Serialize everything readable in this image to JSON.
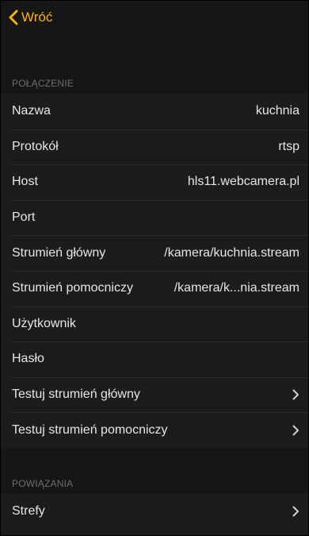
{
  "navbar": {
    "back_label": "Wróć",
    "accent_color": "#f6b400"
  },
  "sections": {
    "connection_header": "POŁĄCZENIE",
    "relations_header": "POWIĄZANIA"
  },
  "connection": {
    "name_label": "Nazwa",
    "name_value": "kuchnia",
    "protocol_label": "Protokół",
    "protocol_value": "rtsp",
    "host_label": "Host",
    "host_value": "hls11.webcamera.pl",
    "port_label": "Port",
    "port_value": "",
    "main_stream_label": "Strumień główny",
    "main_stream_value": "/kamera/kuchnia.stream",
    "aux_stream_label": "Strumień pomocniczy",
    "aux_stream_value": "/kamera/k...nia.stream",
    "user_label": "Użytkownik",
    "user_value": "",
    "password_label": "Hasło",
    "password_value": "",
    "test_main_label": "Testuj strumień główny",
    "test_aux_label": "Testuj strumień pomocniczy",
    "chevron_icon": "chevron-right-icon"
  },
  "relations": {
    "zones_label": "Strefy"
  }
}
